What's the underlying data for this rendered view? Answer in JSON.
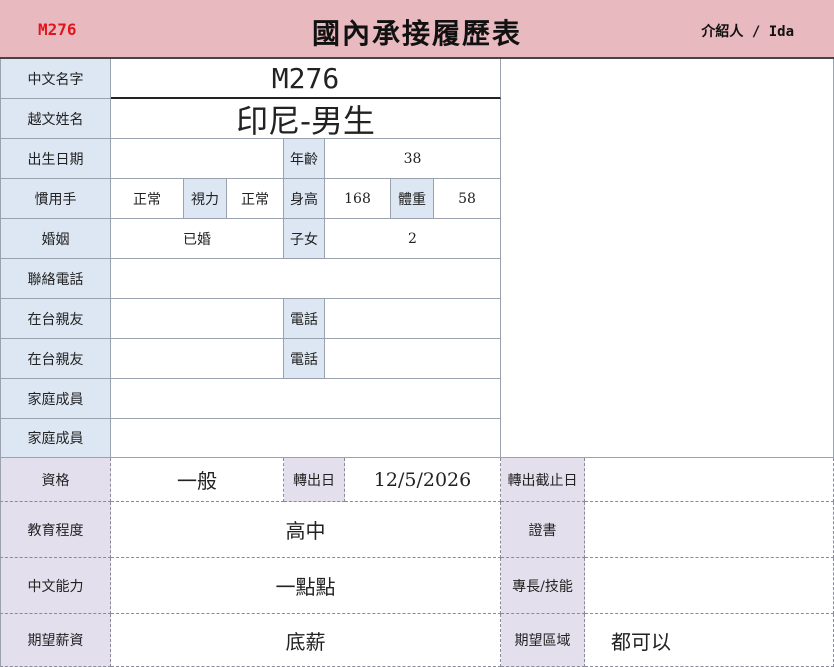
{
  "header": {
    "code": "M276",
    "title": "國內承接履歷表",
    "referrer": "介紹人 / Ida"
  },
  "form": {
    "chinese_name_label": "中文名字",
    "chinese_name": "M276",
    "vietnamese_name_label": "越文姓名",
    "vietnamese_name": "印尼-男生",
    "birth_label": "出生日期",
    "birth": "",
    "age_label": "年齡",
    "age": "38",
    "hand_label": "慣用手",
    "hand": "正常",
    "vision_label": "視力",
    "vision": "正常",
    "height_label": "身高",
    "height": "168",
    "weight_label": "體重",
    "weight": "58",
    "marriage_label": "婚姻",
    "marriage": "已婚",
    "children_label": "子女",
    "children": "2",
    "phone_label": "聯絡電話",
    "phone": "",
    "relative1_label": "在台親友",
    "relative1": "",
    "relative1_phone_label": "電話",
    "relative1_phone": "",
    "relative2_label": "在台親友",
    "relative2": "",
    "relative2_phone_label": "電話",
    "relative2_phone": "",
    "family1_label": "家庭成員",
    "family1": "",
    "family2_label": "家庭成員",
    "family2": "",
    "qualification_label": "資格",
    "qualification": "一般",
    "transfer_date_label": "轉出日",
    "transfer_date": "12/5/2026",
    "transfer_deadline_label": "轉出截止日",
    "transfer_deadline": "",
    "education_label": "教育程度",
    "education": "高中",
    "certificate_label": "證書",
    "certificate": "",
    "chinese_ability_label": "中文能力",
    "chinese_ability": "一點點",
    "skills_label": "專長/技能",
    "skills": "",
    "salary_label": "期望薪資",
    "salary": "底薪",
    "region_label": "期望區域",
    "region": "都可以"
  }
}
